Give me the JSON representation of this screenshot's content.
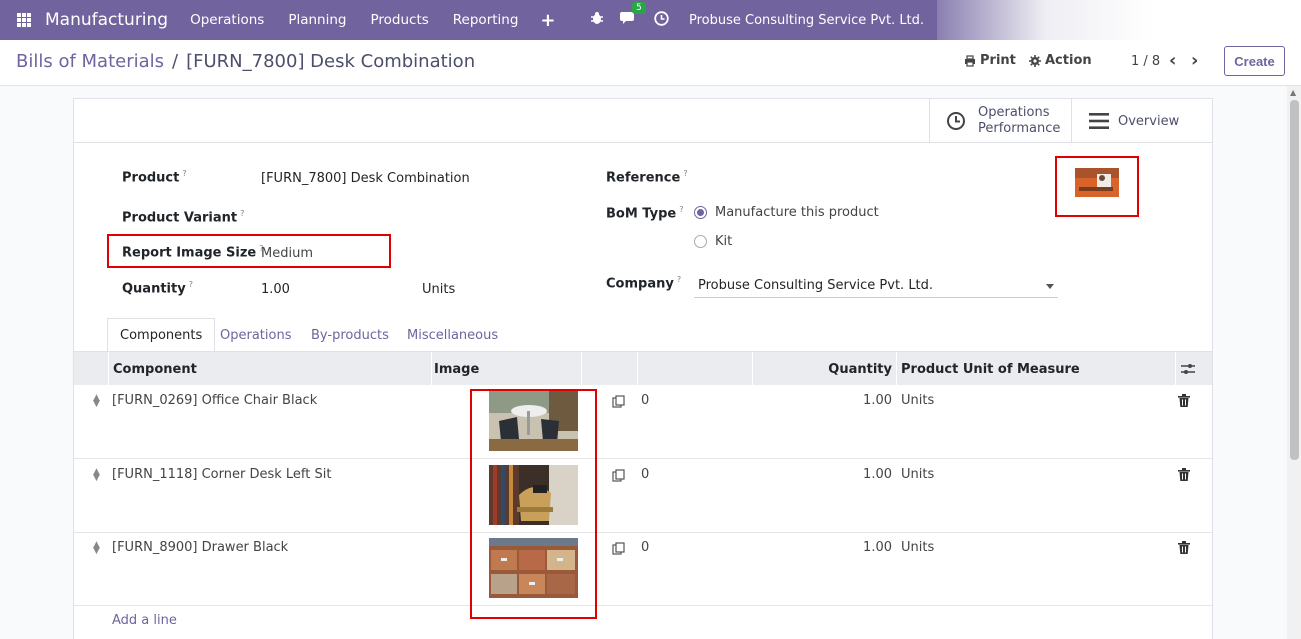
{
  "navbar": {
    "brand": "Manufacturing",
    "menus": [
      "Operations",
      "Planning",
      "Products",
      "Reporting"
    ],
    "plus": "+",
    "chat_badge": "5",
    "company": "Probuse Consulting Service Pvt. Ltd."
  },
  "control": {
    "breadcrumb_parent": "Bills of Materials",
    "breadcrumb_sep": "/",
    "breadcrumb_current": "[FURN_7800] Desk Combination",
    "print_label": "Print",
    "action_label": "Action",
    "pager": "1 / 8",
    "create_label": "Create"
  },
  "stat_buttons": {
    "operations_performance_line1": "Operations",
    "operations_performance_line2": "Performance",
    "overview": "Overview"
  },
  "form": {
    "product_label": "Product",
    "product_value": "[FURN_7800] Desk Combination",
    "variant_label": "Product Variant",
    "report_image_size_label": "Report Image Size",
    "report_image_size_value": "Medium",
    "quantity_label": "Quantity",
    "quantity_value": "1.00",
    "quantity_uom": "Units",
    "reference_label": "Reference",
    "bom_type_label": "BoM Type",
    "bom_type_options": [
      {
        "label": "Manufacture this product",
        "selected": true
      },
      {
        "label": "Kit",
        "selected": false
      }
    ],
    "company_label": "Company",
    "company_value": "Probuse Consulting Service Pvt. Ltd.",
    "help_mark": "?"
  },
  "tabs": [
    "Components",
    "Operations",
    "By-products",
    "Miscellaneous"
  ],
  "table": {
    "headers": {
      "component": "Component",
      "image": "Image",
      "quantity": "Quantity",
      "uom": "Product Unit of Measure"
    },
    "rows": [
      {
        "component": "[FURN_0269] Office Chair Black",
        "avail": "0",
        "quantity": "1.00",
        "uom": "Units"
      },
      {
        "component": "[FURN_1118] Corner Desk Left Sit",
        "avail": "0",
        "quantity": "1.00",
        "uom": "Units"
      },
      {
        "component": "[FURN_8900] Drawer Black",
        "avail": "0",
        "quantity": "1.00",
        "uom": "Units"
      }
    ],
    "add_line": "Add a line"
  },
  "colors": {
    "brand": "#71639e",
    "highlight": "#e00000",
    "badge": "#28a745"
  }
}
